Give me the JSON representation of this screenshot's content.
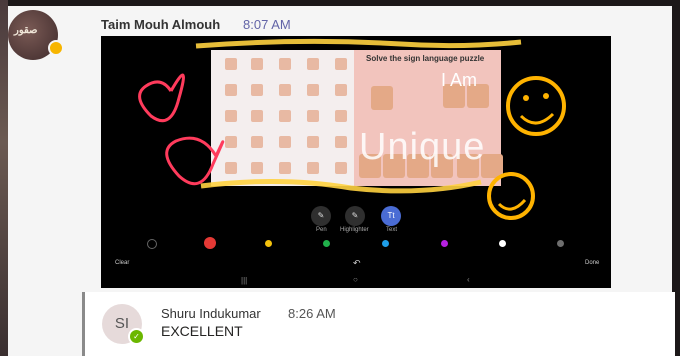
{
  "messages": [
    {
      "sender": "Taim Mouh Almouh",
      "time": "8:07 AM",
      "avatar_text": "صقور"
    },
    {
      "sender": "Shuru Indukumar",
      "time": "8:26 AM",
      "initials": "SI",
      "text": "EXCELLENT"
    }
  ],
  "screenshot": {
    "puzzle_title": "Solve the sign language puzzle",
    "overlay_i_am": "I Am",
    "overlay_word": "Unique",
    "tools": [
      {
        "label": "Pen",
        "glyph": "✎"
      },
      {
        "label": "Highlighter",
        "glyph": "✎"
      },
      {
        "label": "Text",
        "glyph": "Tt"
      }
    ],
    "colors": [
      "#2b2b2b",
      "#e53935",
      "#f4c20d",
      "#21b14b",
      "#1e9ee8",
      "#b620e0",
      "#ffffff",
      "#6e6e6e"
    ],
    "clear_label": "Clear",
    "done_label": "Done",
    "undo_glyph": "↶",
    "nav": [
      "|||",
      "○",
      "‹"
    ]
  },
  "theme": {
    "accent": "#6264a7",
    "away_color": "#f7b500",
    "available_color": "#6bb700"
  }
}
